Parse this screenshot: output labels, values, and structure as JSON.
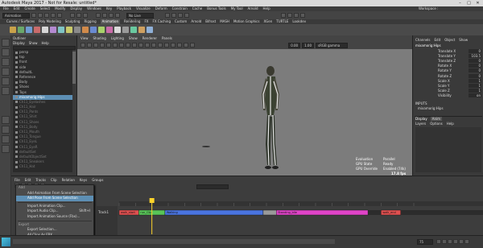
{
  "window": {
    "title": "Autodesk Maya 2017 - Not for Resale: untitled*",
    "controls": [
      "–",
      "□",
      "✕"
    ]
  },
  "menubar": {
    "items": [
      "File",
      "Edit",
      "Create",
      "Select",
      "Modify",
      "Display",
      "Windows",
      "Key",
      "Playback",
      "Visualize",
      "Deform",
      "Constrain",
      "Cache",
      "Bonus Tools",
      "My Tool",
      "Arnold",
      "Help"
    ],
    "workspace_label": "Workspace :"
  },
  "statusline": {
    "mode": "Animation",
    "live_surface": "No Live Surface"
  },
  "shelf": {
    "tabs": [
      "Curves / Surfaces",
      "Poly Modeling",
      "Sculpting",
      "Rigging",
      "Animation",
      "Rendering",
      "FX",
      "FX Caching",
      "Custom",
      "Arnold",
      "Bifrost",
      "MASH",
      "Motion Graphics",
      "XGen",
      "TURTLE",
      "Lookdev"
    ],
    "active_tab": "Animation",
    "icon_colors": [
      "#c9a24a",
      "#6aa86a",
      "#6f9bd1",
      "#c96b6b",
      "#d7d7d7",
      "#b48ad1",
      "#7fc4c4",
      "#c9c96a",
      "#8a8a8a",
      "#d18a4a",
      "#6a8ad1",
      "#a8d16a",
      "#c96ba8",
      "#dadada",
      "#9a9a9a",
      "#6ac9a0",
      "#cfa060",
      "#8fb0d8"
    ]
  },
  "outliner": {
    "title": "Outliner",
    "menus": [
      "Display",
      "Show",
      "Help"
    ],
    "items": [
      {
        "label": "persp",
        "state": "normal"
      },
      {
        "label": "top",
        "state": "normal"
      },
      {
        "label": "front",
        "state": "normal"
      },
      {
        "label": "side",
        "state": "normal"
      },
      {
        "label": "defaultL",
        "state": "normal"
      },
      {
        "label": "Reference",
        "state": "normal"
      },
      {
        "label": "Body",
        "state": "normal"
      },
      {
        "label": "Shoes",
        "state": "normal"
      },
      {
        "label": "Tops",
        "state": "normal"
      },
      {
        "label": "mixamorig:Hips",
        "state": "selected"
      },
      {
        "label": "Ch11_Eyelashes",
        "state": "dim"
      },
      {
        "label": "Ch11_Hair",
        "state": "dim"
      },
      {
        "label": "Ch11_Pants",
        "state": "dim"
      },
      {
        "label": "Ch11_Shirt",
        "state": "dim"
      },
      {
        "label": "Ch11_Shoes",
        "state": "dim"
      },
      {
        "label": "Ch11_Body",
        "state": "dim"
      },
      {
        "label": "Ch11_Mouth",
        "state": "dim"
      },
      {
        "label": "Ch11_Tongue",
        "state": "dim"
      },
      {
        "label": "Ch11_EyeL",
        "state": "dim"
      },
      {
        "label": "Ch11_EyeR",
        "state": "dim"
      },
      {
        "label": "defaultSet",
        "state": "dim"
      },
      {
        "label": "defaultObjectSet",
        "state": "dim"
      },
      {
        "label": "Ch11_Sneakers",
        "state": "dim"
      },
      {
        "label": "Ch11_Hat",
        "state": "dim"
      }
    ]
  },
  "viewport": {
    "menus": [
      "View",
      "Shading",
      "Lighting",
      "Show",
      "Renderer",
      "Panels"
    ],
    "gamma": "sRGB gamma",
    "exposure": "0.00",
    "gamma_value": "1.00",
    "hud": [
      {
        "label": "Evaluation",
        "value": "Parallel"
      },
      {
        "label": "GPU State",
        "value": "Ready"
      },
      {
        "label": "GPU Override",
        "value": "Enabled (74k)"
      }
    ],
    "fps": "17.8 fps"
  },
  "channel_box": {
    "tabs": [
      "Channels",
      "Edit",
      "Object",
      "Show"
    ],
    "node": "mixamorig:Hips",
    "channels": [
      {
        "label": "Translate X",
        "value": "0"
      },
      {
        "label": "Translate Y",
        "value": "103.5"
      },
      {
        "label": "Translate Z",
        "value": "0"
      },
      {
        "label": "Rotate X",
        "value": "0"
      },
      {
        "label": "Rotate Y",
        "value": "0"
      },
      {
        "label": "Rotate Z",
        "value": "0"
      },
      {
        "label": "Scale X",
        "value": "1"
      },
      {
        "label": "Scale Y",
        "value": "1"
      },
      {
        "label": "Scale Z",
        "value": "1"
      },
      {
        "label": "Visibility",
        "value": "on"
      }
    ],
    "inputs_header": "INPUTS",
    "inputs": [
      "mixamorig:Hips"
    ],
    "layer_tabs": [
      "Display",
      "Anim"
    ],
    "layer_menus": [
      "Layers",
      "Options",
      "Help"
    ]
  },
  "time_editor": {
    "menus": [
      "File",
      "Edit",
      "Tracks",
      "Clip",
      "Relation",
      "Keys",
      "Groups"
    ],
    "tracks": [
      {
        "label": "Track1",
        "clips": [
          {
            "label": "walk_start",
            "start": 0,
            "end": 6,
            "color": "#e05050"
          },
          {
            "label": "run_Clip",
            "start": 6,
            "end": 14,
            "color": "#58c458"
          },
          {
            "label": "Walking",
            "start": 14,
            "end": 44,
            "color": "#4a74e0"
          },
          {
            "label": "",
            "start": 44,
            "end": 48,
            "color": "#9a9a9a"
          },
          {
            "label": "Standing_Idle",
            "start": 48,
            "end": 76,
            "color": "#e044c8"
          },
          {
            "label": "walk_end",
            "start": 80,
            "end": 86,
            "color": "#e05050"
          }
        ]
      }
    ],
    "track_colors": {
      "track_bg": "#2c2c2c",
      "ruler": "#333",
      "playhead": "#ffd42a"
    }
  },
  "context_menu": {
    "items": [
      {
        "label": "Add",
        "kind": "header"
      },
      {
        "label": "Add Animation From Scene Selection",
        "kind": "item"
      },
      {
        "label": "Add Pose From Scene Selection",
        "kind": "selected"
      },
      {
        "label": "",
        "kind": "separator"
      },
      {
        "label": "Import Animation Clip...",
        "kind": "item"
      },
      {
        "label": "Import Audio Clip...",
        "kind": "item",
        "shortcut": "Shift+I"
      },
      {
        "label": "Import Animation Source (Fbx)...",
        "kind": "item"
      },
      {
        "label": "",
        "kind": "separator"
      },
      {
        "label": "Export",
        "kind": "header"
      },
      {
        "label": "Export Selection...",
        "kind": "item"
      },
      {
        "label": "All Clips As FBX...",
        "kind": "item"
      },
      {
        "label": "",
        "kind": "separator"
      },
      {
        "label": "Open Game Exporter...",
        "kind": "item"
      },
      {
        "label": "Open Content Browser...",
        "kind": "item"
      }
    ]
  },
  "playback": {
    "current_frame": "1",
    "end_frame": "75",
    "fps": "24 fps"
  }
}
